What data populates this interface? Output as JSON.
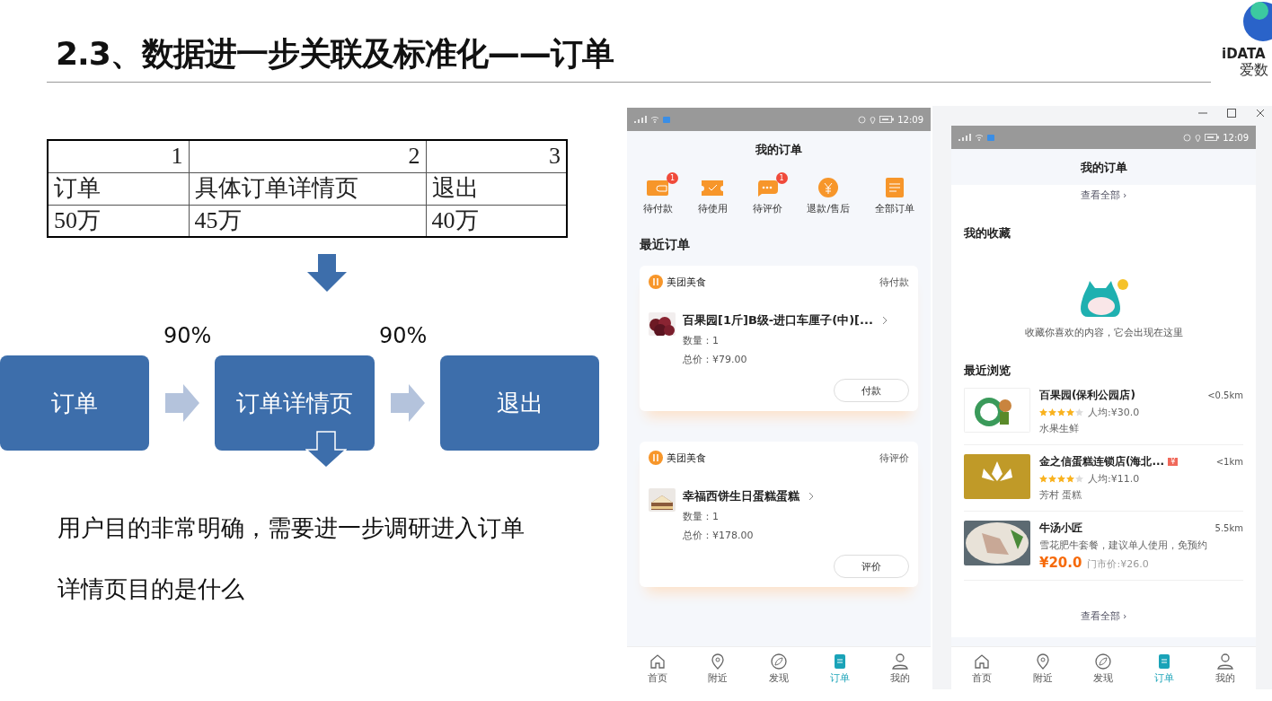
{
  "slide": {
    "title": "2.3、数据进一步关联及标准化——订单",
    "logo": {
      "brand": "iDATA",
      "name": "爱数"
    }
  },
  "table": {
    "header": [
      "1",
      "2",
      "3"
    ],
    "rows": [
      [
        "订单",
        "具体订单详情页",
        "退出"
      ],
      [
        "50万",
        "45万",
        "40万"
      ]
    ]
  },
  "flow": {
    "steps": [
      "订单",
      "订单详情页",
      "退出"
    ],
    "rates": [
      "90%",
      "90%"
    ]
  },
  "note": "用户目的非常明确，需要进一步调研进入订单详情页目的是什么",
  "phone_orders": {
    "status_time": "12:09",
    "title": "我的订单",
    "shortcuts": [
      {
        "label": "待付款",
        "badge": "1"
      },
      {
        "label": "待使用"
      },
      {
        "label": "待评价",
        "badge": "1"
      },
      {
        "label": "退款/售后"
      },
      {
        "label": "全部订单"
      }
    ],
    "section": "最近订单",
    "orders": [
      {
        "shop": "美团美食",
        "status": "待付款",
        "item": "百果园[1斤]B级-进口车厘子(中)[...",
        "quantity": "数量：1",
        "total": "总价：¥79.00",
        "action": "付款"
      },
      {
        "shop": "美团美食",
        "status": "待评价",
        "item": "幸福西饼生日蛋糕蛋糕",
        "quantity": "数量：1",
        "total": "总价：¥178.00",
        "action": "评价"
      }
    ],
    "nav": [
      {
        "label": "首页",
        "selected": false
      },
      {
        "label": "附近",
        "selected": false
      },
      {
        "label": "发现",
        "selected": false
      },
      {
        "label": "订单",
        "selected": true
      },
      {
        "label": "我的",
        "selected": false
      }
    ]
  },
  "phone_profile": {
    "status_time": "12:09",
    "title": "我的订单",
    "top_link": "查看全部 ›",
    "favorites": {
      "title": "我的收藏",
      "empty_text": "收藏你喜欢的内容，它会出现在这里"
    },
    "recent": {
      "title": "最近浏览",
      "items": [
        {
          "kind": "shop",
          "name": "百果园(保利公园店)",
          "distance": "<0.5km",
          "stars": 4,
          "average": "人均:¥30.0",
          "tags": "水果生鲜"
        },
        {
          "kind": "shop",
          "name": "金之信蛋糕连锁店(海北...",
          "tag": "¥",
          "distance": "<1km",
          "stars": 4,
          "average": "人均:¥11.0",
          "tags": "芳村  蛋糕"
        },
        {
          "kind": "deal",
          "name": "牛汤小匠",
          "distance": "5.5km",
          "description": "雪花肥牛套餐，建议单人使用，免预约",
          "price": "¥20.0",
          "original_price": "门市价:¥26.0"
        }
      ],
      "link": "查看全部 ›"
    },
    "nav": [
      {
        "label": "首页",
        "selected": false
      },
      {
        "label": "附近",
        "selected": false
      },
      {
        "label": "发现",
        "selected": false
      },
      {
        "label": "订单",
        "selected": true
      },
      {
        "label": "我的",
        "selected": false
      }
    ]
  }
}
